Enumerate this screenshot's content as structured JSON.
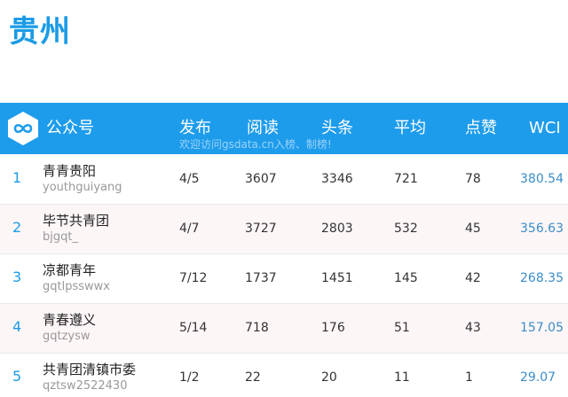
{
  "region": "贵州",
  "header": {
    "account": "公众号",
    "publish": "发布",
    "read": "阅读",
    "headline": "头条",
    "average": "平均",
    "likes": "点赞",
    "wci": "WCI",
    "watermark": "欢迎访问gsdata.cn入榜、制榜!",
    "logo_icon": "infinity-icon"
  },
  "colors": {
    "accent": "#1e9cec",
    "title": "#1a9be6",
    "alt_row": "#fdf6f7",
    "wci": "#3a8dc9"
  },
  "rows": [
    {
      "rank": "1",
      "name": "青青贵阳",
      "id": "youthguiyang",
      "publish": "4/5",
      "read": "3607",
      "headline": "3346",
      "average": "721",
      "likes": "78",
      "wci": "380.54"
    },
    {
      "rank": "2",
      "name": "毕节共青团",
      "id": "bjgqt_",
      "publish": "4/7",
      "read": "3727",
      "headline": "2803",
      "average": "532",
      "likes": "45",
      "wci": "356.63"
    },
    {
      "rank": "3",
      "name": "凉都青年",
      "id": "gqtlpsswwx",
      "publish": "7/12",
      "read": "1737",
      "headline": "1451",
      "average": "145",
      "likes": "42",
      "wci": "268.35"
    },
    {
      "rank": "4",
      "name": "青春遵义",
      "id": "gqtzysw",
      "publish": "5/14",
      "read": "718",
      "headline": "176",
      "average": "51",
      "likes": "43",
      "wci": "157.05"
    },
    {
      "rank": "5",
      "name": "共青团清镇市委",
      "id": "qztsw2522430",
      "publish": "1/2",
      "read": "22",
      "headline": "20",
      "average": "11",
      "likes": "1",
      "wci": "29.07"
    }
  ]
}
